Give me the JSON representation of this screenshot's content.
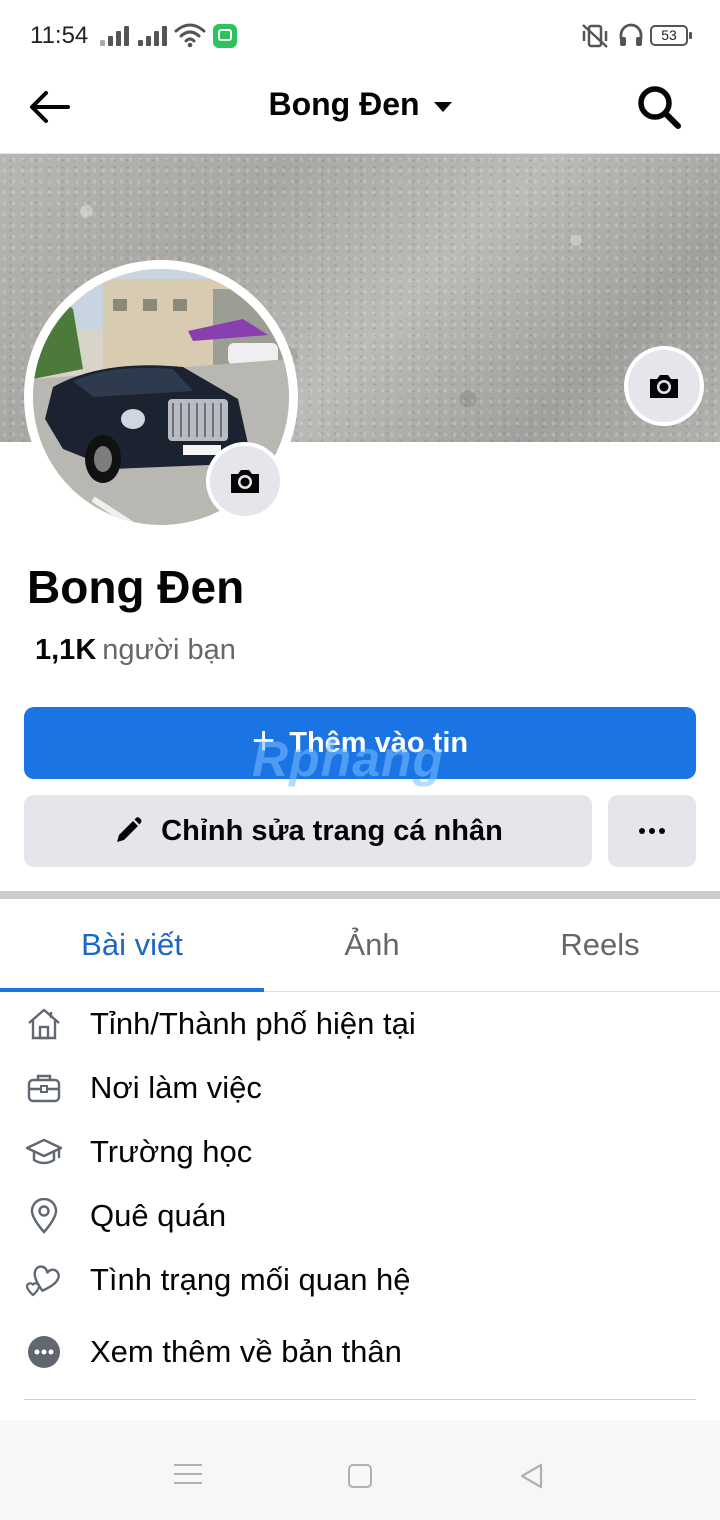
{
  "status_bar": {
    "time": "11:54",
    "battery": "53",
    "icons": [
      "signal-icon",
      "signal-icon",
      "wifi-icon",
      "message-app-icon",
      "vibrate-mute-icon",
      "headset-icon",
      "battery-icon"
    ]
  },
  "app_bar": {
    "title": "Bong Đen",
    "back_icon": "arrow-left-icon",
    "search_icon": "search-icon",
    "caret_icon": "caret-down-icon"
  },
  "profile": {
    "name": "Bong Đen",
    "friends_count": "1,1K",
    "friends_label": "người bạn"
  },
  "actions": {
    "add_story_plus": "+",
    "add_story_label": "Thêm vào tin",
    "edit_profile_label": "Chỉnh sửa trang cá nhân",
    "more_label": "···"
  },
  "watermark": "Rphang",
  "tabs": [
    {
      "label": "Bài viết",
      "active": true
    },
    {
      "label": "Ảnh",
      "active": false
    },
    {
      "label": "Reels",
      "active": false
    }
  ],
  "details": [
    {
      "icon": "home-icon",
      "label": "Tỉnh/Thành phố hiện tại"
    },
    {
      "icon": "briefcase-icon",
      "label": "Nơi làm việc"
    },
    {
      "icon": "graduation-cap-icon",
      "label": "Trường học"
    },
    {
      "icon": "location-pin-icon",
      "label": "Quê quán"
    },
    {
      "icon": "hearts-icon",
      "label": "Tình trạng mối quan hệ"
    },
    {
      "icon": "more-dots-icon",
      "label": "Xem thêm về bản thân"
    }
  ],
  "colors": {
    "primary": "#1b74e4",
    "secondary_button": "#e4e6eb",
    "active_tab": "#1b66c9",
    "muted_text": "#65676b"
  }
}
